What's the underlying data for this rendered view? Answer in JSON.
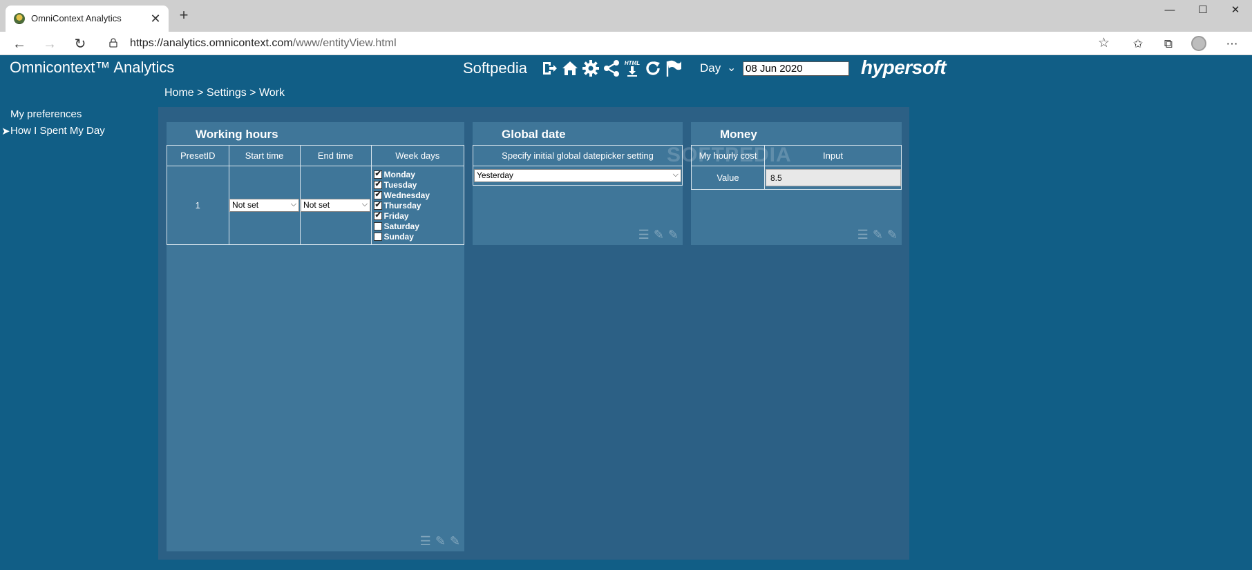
{
  "browser": {
    "tab_title": "OmniContext Analytics",
    "url_host": "https://analytics.omnicontext.com",
    "url_path": "/www/entityView.html"
  },
  "header": {
    "app_title": "Omnicontext™ Analytics",
    "user_name": "Softpedia",
    "icons": [
      "logout-icon",
      "home-icon",
      "gear-icon",
      "share-icon",
      "html-export-icon",
      "refresh-icon",
      "flag-icon"
    ],
    "html_badge": "HTML",
    "period_label": "Day",
    "date_value": "08 Jun 2020",
    "brand": "hypersoft"
  },
  "breadcrumb": "Home > Settings > Work",
  "sidebar": {
    "items": [
      {
        "label": "My preferences"
      },
      {
        "label": "How I Spent My Day"
      }
    ],
    "arrow": "➤"
  },
  "working_hours": {
    "title": "Working hours",
    "columns": [
      "PresetID",
      "Start time",
      "End time",
      "Week days"
    ],
    "row": {
      "preset_id": "1",
      "start_time": "Not set",
      "end_time": "Not set",
      "week_days": [
        {
          "label": "Monday",
          "checked": true
        },
        {
          "label": "Tuesday",
          "checked": true
        },
        {
          "label": "Wednesday",
          "checked": true
        },
        {
          "label": "Thursday",
          "checked": true
        },
        {
          "label": "Friday",
          "checked": true
        },
        {
          "label": "Saturday",
          "checked": false
        },
        {
          "label": "Sunday",
          "checked": false
        }
      ]
    }
  },
  "global_date": {
    "title": "Global date",
    "column": "Specify initial global datepicker setting",
    "value": "Yesterday"
  },
  "money": {
    "title": "Money",
    "columns": [
      "My hourly cost",
      "Input"
    ],
    "row_label": "Value",
    "value": "8.5"
  },
  "watermark": "SOFTPEDIA",
  "colors": {
    "page_bg": "#115e86",
    "panel_bg": "#2c6085",
    "card_bg": "#3f7699"
  }
}
